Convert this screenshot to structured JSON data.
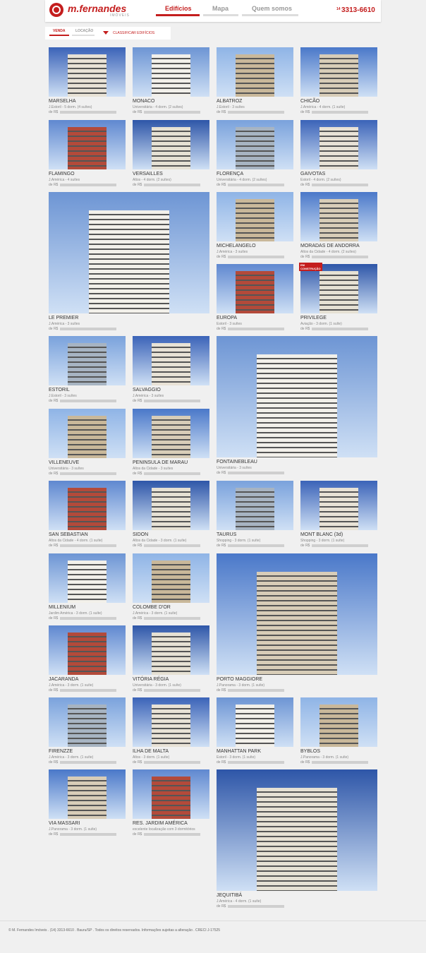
{
  "brand": {
    "name": "m.fernandes",
    "sub": "IMÓVEIS",
    "phone_ddd": "14",
    "phone": "3313-6610"
  },
  "nav": [
    {
      "label": "Edifícios",
      "active": true
    },
    {
      "label": "Mapa",
      "active": false
    },
    {
      "label": "Quem somos",
      "active": false
    }
  ],
  "toolbar": {
    "tab_venda": "VENDA",
    "tab_locacao": "LOCAÇÃO",
    "sort_label": "CLASSIFICAR EDIFÍCIOS"
  },
  "colors": {
    "brand_red": "#c41e1e"
  },
  "buildings": [
    {
      "name": "MARSELHA",
      "desc": "J.Estoril - 5 dorm. (4 suítes)",
      "price": "de R$"
    },
    {
      "name": "MONACO",
      "desc": "Universitária - 4 dorm. (2 suítes)",
      "price": "de R$"
    },
    {
      "name": "ALBATROZ",
      "desc": "J.Estoril - 3 suítes",
      "price": "de R$"
    },
    {
      "name": "CHICÃO",
      "desc": "J.América - 4 dorm. (1 suíte)",
      "price": "de R$"
    },
    {
      "name": "FLAMINGO",
      "desc": "J.América - 4 suítes",
      "price": "de R$"
    },
    {
      "name": "VERSAILLES",
      "desc": "Altos - 4 dorm. (2 suítes)",
      "price": "de R$"
    },
    {
      "name": "FLORENÇA",
      "desc": "Universitária - 4 dorm. (2 suítes)",
      "price": "de R$"
    },
    {
      "name": "GAIVOTAS",
      "desc": "Estoril - 4 dorm. (2 suítes)",
      "price": "de R$"
    },
    {
      "name": "LE PREMIER",
      "desc": "J.América - 3 suítes",
      "price": "de R$"
    },
    {
      "name": "MICHELANGELO",
      "desc": "J.América - 3 suítes",
      "price": "de R$"
    },
    {
      "name": "MORADAS DE ANDORRA",
      "desc": "Altos da Cidade - 4 dorm. (2 suítes)",
      "price": "de R$"
    },
    {
      "name": "EUROPA",
      "desc": "Estoril - 3 suítes",
      "price": "de R$"
    },
    {
      "name": "PRIVILEGE",
      "desc": "Aviação - 3 dorm. (1 suíte)",
      "price": "de R$",
      "badge": "EM CONSTRUÇÃO"
    },
    {
      "name": "ESTORIL",
      "desc": "J.Estoril - 3 suítes",
      "price": "de R$"
    },
    {
      "name": "SALVAGGIO",
      "desc": "J.América - 3 suítes",
      "price": "de R$"
    },
    {
      "name": "FONTAINEBLEAU",
      "desc": "Universitária - 3 suítes",
      "price": "de R$"
    },
    {
      "name": "VILLENEUVE",
      "desc": "Universitária - 3 suítes",
      "price": "de R$"
    },
    {
      "name": "PENINSULA DE MARAU",
      "desc": "Altos da Cidade - 3 suítes",
      "price": "de R$"
    },
    {
      "name": "SAN SEBASTIAN",
      "desc": "Altos da Cidade - 4 dorm. (1 suíte)",
      "price": "de R$"
    },
    {
      "name": "SIDON",
      "desc": "Altos da Cidade - 3 dorm. (1 suíte)",
      "price": "de R$"
    },
    {
      "name": "TAURUS",
      "desc": "Shopping - 3 dorm. (1 suíte)",
      "price": "de R$"
    },
    {
      "name": "MONT BLANC (3d)",
      "desc": "Shopping - 3 dorm. (1 suíte)",
      "price": "de R$"
    },
    {
      "name": "MILLENIUM",
      "desc": "Jardim América - 3 dorm. (1 suíte)",
      "price": "de R$"
    },
    {
      "name": "COLOMBE D'OR",
      "desc": "J.América - 3 dorm. (1 suíte)",
      "price": "de R$"
    },
    {
      "name": "PORTO MAGGIORE",
      "desc": "J.Panorama - 3 dorm. (1 suíte)",
      "price": "de R$"
    },
    {
      "name": "JACARANDA",
      "desc": "J.América - 3 dorm. (1 suíte)",
      "price": "de R$"
    },
    {
      "name": "VITÓRIA RÉGIA",
      "desc": "Universitária - 3 dorm. (1 suíte)",
      "price": "de R$"
    },
    {
      "name": "FIRENZZE",
      "desc": "J.América - 3 dorm. (1 suíte)",
      "price": "de R$"
    },
    {
      "name": "ILHA DE MALTA",
      "desc": "Altos - 3 dorm. (1 suíte)",
      "price": "de R$"
    },
    {
      "name": "MANHATTAN PARK",
      "desc": "Estoril - 3 dorm. (1 suíte)",
      "price": "de R$"
    },
    {
      "name": "BYBLOS",
      "desc": "J.Panorama - 3 dorm. (1 suíte)",
      "price": "de R$"
    },
    {
      "name": "VIA MASSARI",
      "desc": "J.Panorama - 3 dorm. (1 suíte)",
      "price": "de R$"
    },
    {
      "name": "RES. JARDIM AMÉRICA",
      "desc": "excelente localização com 3 dormitórios",
      "price": "de R$"
    },
    {
      "name": "JEQUITIBÁ",
      "desc": "J.América - 4 dorm. (1 suíte)",
      "price": "de R$"
    }
  ],
  "footer": "© M. Fernandes Imóveis . (14) 3313-6610 . Bauru/SP . Todos os direitos reservados. Informações sujeitas a alteração . CRECI J-17525"
}
